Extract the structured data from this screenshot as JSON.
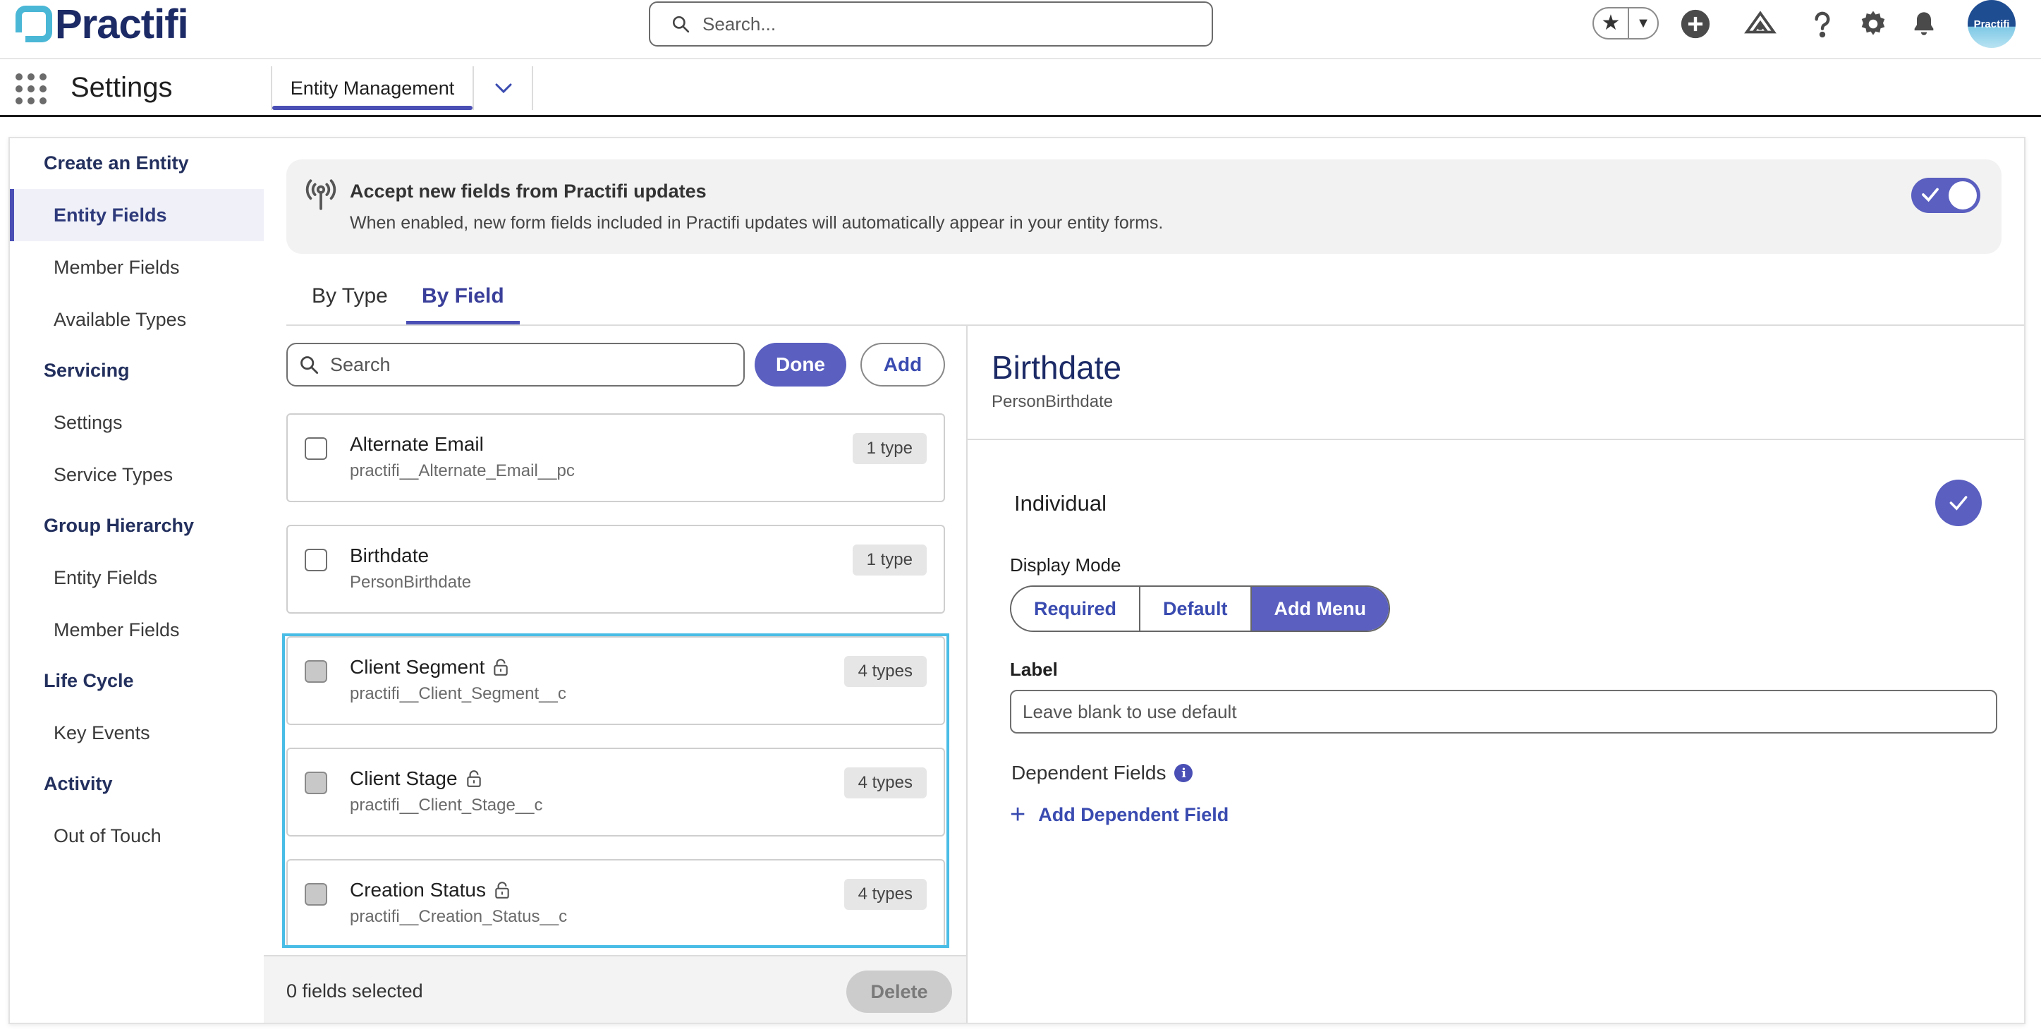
{
  "header": {
    "logo_text": "Practifi",
    "search_placeholder": "Search...",
    "avatar_text": "Practifi"
  },
  "nav": {
    "app_name": "Settings",
    "active_tab": "Entity Management"
  },
  "sidebar": {
    "sections": [
      {
        "title": "Create an Entity",
        "items": [
          "Entity Fields",
          "Member Fields",
          "Available Types"
        ]
      },
      {
        "title": "Servicing",
        "items": [
          "Settings",
          "Service Types"
        ]
      },
      {
        "title": "Group Hierarchy",
        "items": [
          "Entity Fields",
          "Member Fields"
        ]
      },
      {
        "title": "Life Cycle",
        "items": [
          "Key Events"
        ]
      },
      {
        "title": "Activity",
        "items": [
          "Out of Touch"
        ]
      }
    ],
    "active_item": "Entity Fields"
  },
  "banner": {
    "title": "Accept new fields from Practifi updates",
    "description": "When enabled, new form fields included in Practifi updates will automatically appear in your entity forms.",
    "toggle_on": true
  },
  "tabs": {
    "by_type": "By Type",
    "by_field": "By Field",
    "active": "By Field"
  },
  "list": {
    "search_placeholder": "Search",
    "done_label": "Done",
    "add_label": "Add",
    "fields": [
      {
        "name": "Alternate Email",
        "api": "practifi__Alternate_Email__pc",
        "badge": "1 type",
        "locked": false
      },
      {
        "name": "Birthdate",
        "api": "PersonBirthdate",
        "badge": "1 type",
        "locked": false
      },
      {
        "name": "Client Segment",
        "api": "practifi__Client_Segment__c",
        "badge": "4 types",
        "locked": true
      },
      {
        "name": "Client Stage",
        "api": "practifi__Client_Stage__c",
        "badge": "4 types",
        "locked": true
      },
      {
        "name": "Creation Status",
        "api": "practifi__Creation_Status__c",
        "badge": "4 types",
        "locked": true
      }
    ],
    "selected_count": "0 fields selected",
    "delete_label": "Delete"
  },
  "detail": {
    "title": "Birthdate",
    "api": "PersonBirthdate",
    "type_name": "Individual",
    "display_mode_label": "Display Mode",
    "modes": [
      "Required",
      "Default",
      "Add Menu"
    ],
    "active_mode": "Add Menu",
    "label_heading": "Label",
    "label_placeholder": "Leave blank to use default",
    "dependent_fields_label": "Dependent Fields",
    "add_dependent_label": "Add Dependent Field"
  },
  "colors": {
    "accent": "#5a5fc0",
    "brand_navy": "#1c2a66",
    "logo_teal": "#4ab7d6",
    "drop_highlight": "#49bde6"
  }
}
